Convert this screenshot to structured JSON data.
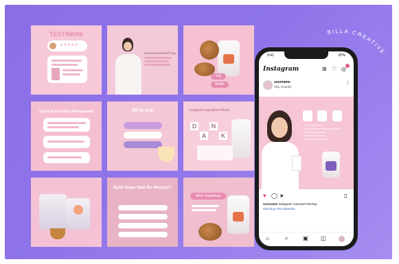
{
  "brand": {
    "text": "BILLA CREATIVE"
  },
  "tiles": {
    "t1": {
      "title": "TESTIMONI"
    },
    "t2": {
      "title": "Homepinnedstuff tips"
    },
    "t3": {
      "label1": "Eat",
      "label2": "Better"
    },
    "t4": {
      "title": "Cuma Solusi Bisa Menyayiwal"
    },
    "t5": {
      "title": "All in one"
    },
    "t6": {
      "title": "Langkah Ingredient Buat",
      "letters": [
        "D",
        "A",
        "N",
        "K"
      ]
    },
    "t8": {
      "title": "Apah Siapa Saat Bu Menyayi?"
    },
    "t9": {
      "title": "Mom Superfood"
    }
  },
  "phone": {
    "time": "9:41",
    "battery": "87%",
    "app": "Instagram",
    "account": "username",
    "location": "City, Country",
    "bullets": [
      "Sup akan lezat",
      "Mudahkan menyiapkan makanan",
      "Resep yang lembut",
      "Bebas bahan kimia",
      "Variasi resep menarik"
    ],
    "caption_user": "username",
    "caption_text": "Instagram Carousel Mockup",
    "hashtags": "#Mockup #SocialMedia"
  },
  "colors": {
    "accent": "#e05c8a",
    "background": "#8f74ea",
    "tile_pink": "#f6c8d8"
  }
}
